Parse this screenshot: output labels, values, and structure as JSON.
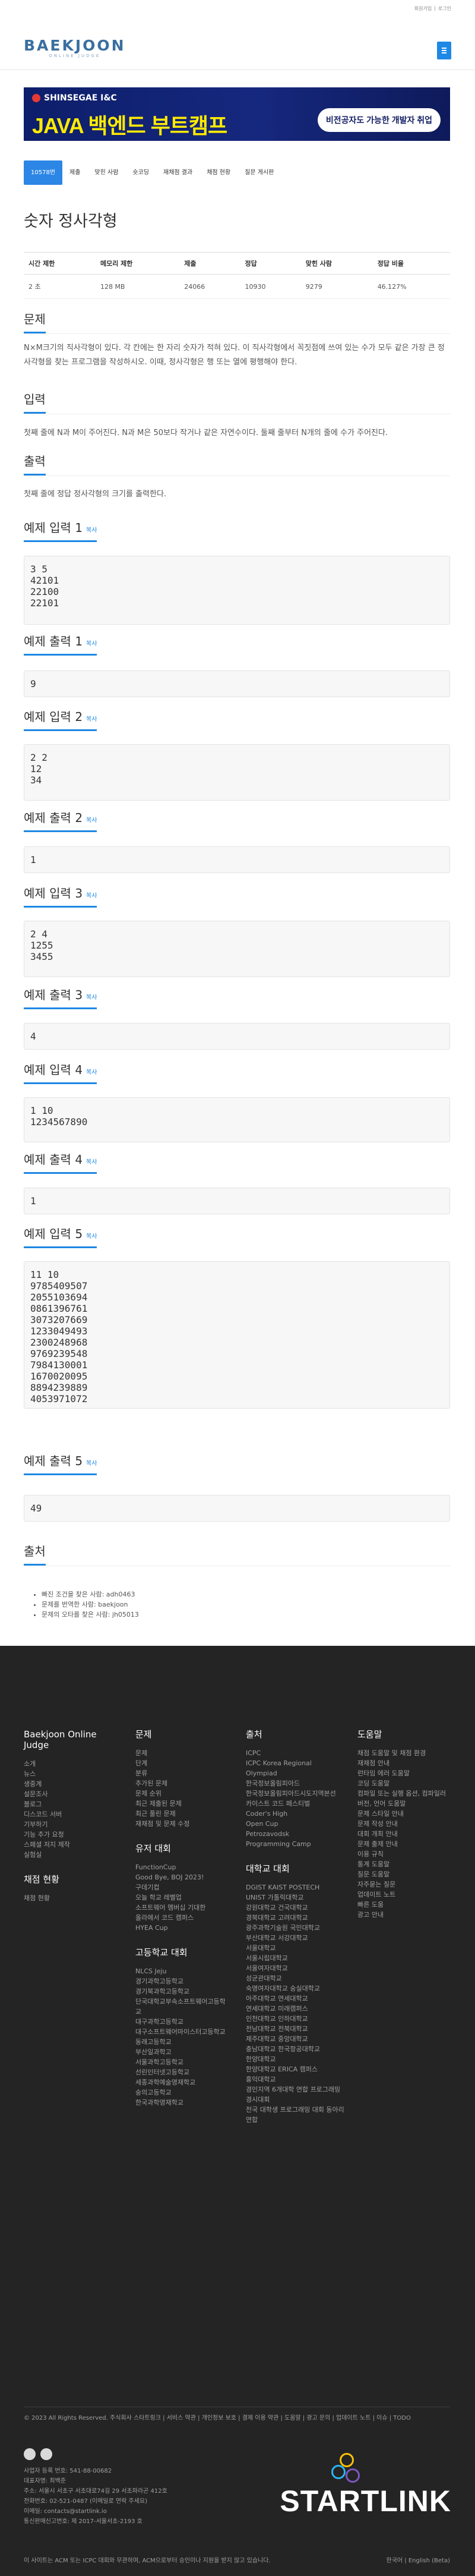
{
  "topbar": {
    "signup": "회원가입",
    "sep": "|",
    "login": "로그인"
  },
  "logo": {
    "word": "BAEKJOON",
    "sub": "ONLINE JUDGE"
  },
  "ad": {
    "brand": "SHINSEGAE I&C",
    "headline": "JAVA 백엔드 부트캠프",
    "pill": "비전공자도 가능한 개발자 취업"
  },
  "tabs": [
    "10578번",
    "제출",
    "맞힌 사람",
    "숏코딩",
    "재채점 결과",
    "채점 현황",
    "질문 게시판"
  ],
  "title": "숫자 정사각형",
  "info_table": {
    "headers": [
      "시간 제한",
      "메모리 제한",
      "제출",
      "정답",
      "맞힌 사람",
      "정답 비율"
    ],
    "row": [
      "2 초",
      "128 MB",
      "24066",
      "10930",
      "9279",
      "46.127%"
    ]
  },
  "sections": {
    "problem": "문제",
    "problem_text": "N×M크기의 직사각형이 있다. 각 칸에는 한 자리 숫자가 적혀 있다. 이 직사각형에서 꼭짓점에 쓰여 있는 수가 모두 같은 가장 큰 정사각형을 찾는 프로그램을 작성하시오. 이때, 정사각형은 행 또는 열에 평행해야 한다.",
    "input": "입력",
    "input_text": "첫째 줄에 N과 M이 주어진다. N과 M은 50보다 작거나 같은 자연수이다. 둘째 줄부터 N개의 줄에 수가 주어진다.",
    "output": "출력",
    "output_text": "첫째 줄에 정답 정사각형의 크기를 출력한다.",
    "limits": "출처"
  },
  "copy_label": "복사",
  "samples": [
    {
      "in_title": "예제 입력 1",
      "in": "3 5\n42101\n22100\n22101",
      "out_title": "예제 출력 1",
      "out": "9"
    },
    {
      "in_title": "예제 입력 2",
      "in": "2 2\n12\n34",
      "out_title": "예제 출력 2",
      "out": "1"
    },
    {
      "in_title": "예제 입력 3",
      "in": "2 4\n1255\n3455",
      "out_title": "예제 출력 3",
      "out": "4"
    },
    {
      "in_title": "예제 입력 4",
      "in": "1 10\n1234567890",
      "out_title": "예제 출력 4",
      "out": "1"
    },
    {
      "in_title": "예제 입력 5",
      "in": "11 10\n9785409507\n2055103694\n0861396761\n3073207669\n1233049493\n2300248968\n9769239548\n7984130001\n1670020095\n8894239889\n4053971072",
      "out_title": "예제 출력 5",
      "out": "49"
    }
  ],
  "source_links": [
    "빠진 조건을 찾은 사람: adh0463",
    "문제를 번역한 사람: baekjoon",
    "문제의 오타를 찾은 사람: jh05013"
  ],
  "footer": {
    "col1": {
      "title": "Baekjoon Online Judge",
      "items": [
        "소개",
        "뉴스",
        "생중계",
        "설문조사",
        "블로그",
        "디스코드 서버",
        "기부하기",
        "기능 추가 요청",
        "스페셜 저지 제작",
        "실험실"
      ],
      "sub_title": "채점 현황",
      "sub_items": [
        "채점 현황"
      ]
    },
    "col2": {
      "title": "문제",
      "items": [
        "문제",
        "단계",
        "분류",
        "추가된 문제",
        "문제 순위",
        "최근 제출된 문제",
        "최근 풀린 문제",
        "재채점 및 문제 수정"
      ],
      "sub_title": "유저 대회",
      "sub_items": [
        "FunctionCup",
        "Good Bye, BOJ 2023!",
        "구데기컵",
        "오늘 학교 레벨업",
        "소프트웨어 멤버십 기대한",
        "올라에서 코드 캠퍼스",
        "HYEA Cup"
      ],
      "sub2_title": "고등학교 대회",
      "sub2_items": [
        "NLCS Jeju",
        "경기과학고등학교",
        "경기북과학고등학교",
        "단국대학교부속소프트웨어고등학교",
        "대구과학고등학교",
        "대구소프트웨어마이스터고등학교",
        "동래고등학교",
        "부산일과학고",
        "서울과학고등학교",
        "선린인터넷고등학교",
        "세종과학예술영재학교",
        "숭의고등학교",
        "한국과학영재학교"
      ]
    },
    "col3": {
      "title": "출처",
      "items": [
        "ICPC",
        "ICPC Korea Regional",
        "Olympiad",
        "한국정보올림피아드",
        "한국정보올림피아드시도지역본선",
        "카이스트 코드 페스티벌",
        "Coder's High",
        "Open Cup",
        "Petrozavodsk",
        "Programming Camp"
      ],
      "sub_title": "대학교 대회",
      "sub_items": [
        "DGIST KAIST POSTECH",
        "UNIST 가톨릭대학교",
        "강원대학교 건국대학교",
        "경북대학교 고려대학교",
        "광주과학기술원 국민대학교",
        "부산대학교 서강대학교",
        "서울대학교",
        "서울시립대학교",
        "서울여자대학교",
        "성균관대학교",
        "숙명여자대학교 숭실대학교",
        "아주대학교 연세대학교",
        "연세대학교 미래캠퍼스",
        "인천대학교 인하대학교",
        "전남대학교 전북대학교",
        "제주대학교 중앙대학교",
        "충남대학교 한국항공대학교",
        "한양대학교",
        "한양대학교 ERICA 캠퍼스",
        "홍익대학교",
        "경인지역 6개대학 연합 프로그래밍 경시대회",
        "전국 대학생 프로그래밍 대회 동아리 연합"
      ]
    },
    "col4": {
      "title": "도움말",
      "items": [
        "채점 도움말 및 채점 환경",
        "재채점 안내",
        "런타임 에러 도움말",
        "코딩 도움말",
        "컴파일 또는 실행 옵션, 컴파일러 버전, 언어 도움말",
        "문제 스타일 안내",
        "문제 작성 안내",
        "대회 개최 안내",
        "문제 출제 안내",
        "이용 규칙",
        "통계 도움말",
        "질문 도움말",
        "자주묻는 질문",
        "업데이트 노트",
        "빠른 도움",
        "광고 안내"
      ]
    },
    "bottom": "© 2023 All Rights Reserved. 주식회사 스타트링크 | 서비스 약관 | 개인정보 보호 | 결제 이용 약관 | 도움말 | 광고 문의 | 업데이트 노트 | 이슈 | TODO",
    "info": [
      "사업자 등록 번호: 541-88-00682",
      "대표자명: 최백준",
      "주소: 서울시 서초구 서초대로74길 29 서초파라곤 412호",
      "전화번호: 02-521-0487 (이메일로 연락 주세요)",
      "이메일: contacts@startlink.io",
      "통신판매신고번호: 제 2017-서울서초-2193 호"
    ],
    "startlink": "STARTLINK",
    "last_left": "이 사이트는 ACM 또는 ICPC 대회와 무관하며, ACM으로부터 승인이나 지원을 받지 않고 있습니다.",
    "last_right": "한국어 | English (Beta)"
  }
}
